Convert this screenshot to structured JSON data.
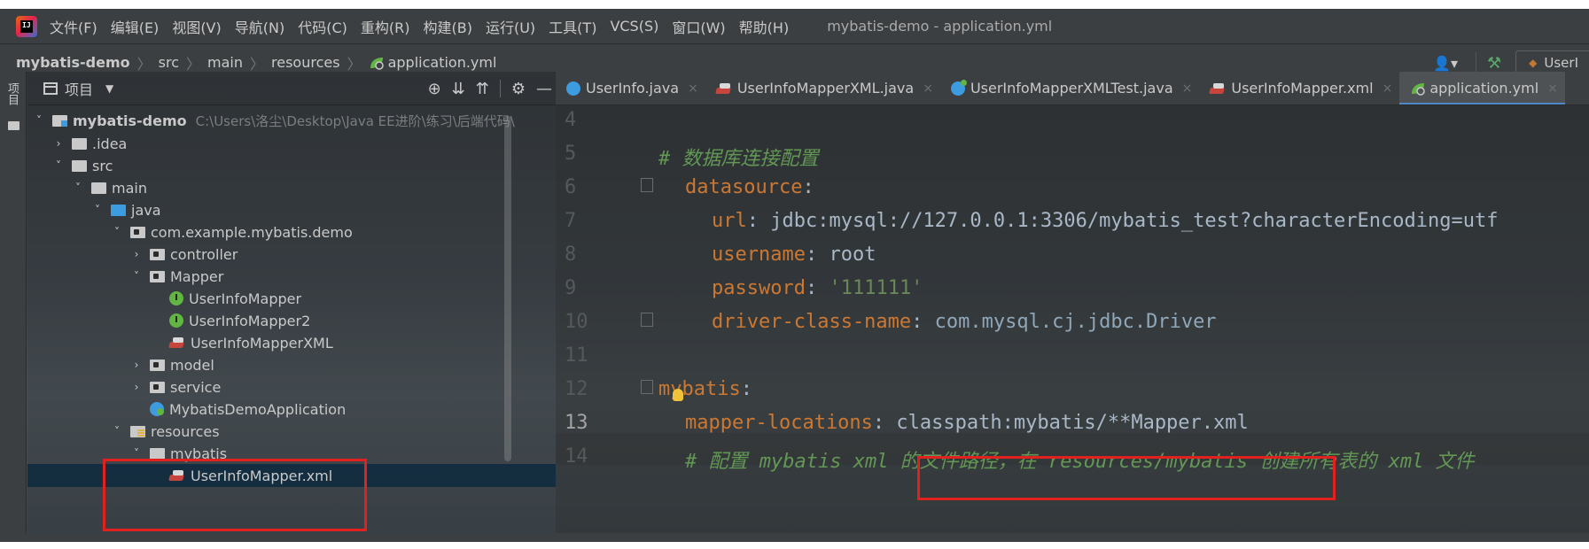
{
  "menubar": {
    "logo_text": "IJ",
    "items": [
      "文件(F)",
      "编辑(E)",
      "视图(V)",
      "导航(N)",
      "代码(C)",
      "重构(R)",
      "构建(B)",
      "运行(U)",
      "工具(T)",
      "VCS(S)",
      "窗口(W)",
      "帮助(H)"
    ],
    "window_title": "mybatis-demo - application.yml"
  },
  "navbar": {
    "breadcrumbs": [
      "mybatis-demo",
      "src",
      "main",
      "resources",
      "application.yml"
    ],
    "run_config": "UserI"
  },
  "left_stripe": {
    "label": "项目"
  },
  "project_panel": {
    "title": "项目",
    "tree": [
      {
        "label": "mybatis-demo",
        "detail": "C:\\Users\\洛尘\\Desktop\\Java EE进阶\\练习\\后端代码\\"
      },
      {
        "label": ".idea"
      },
      {
        "label": "src"
      },
      {
        "label": "main"
      },
      {
        "label": "java"
      },
      {
        "label": "com.example.mybatis.demo"
      },
      {
        "label": "controller"
      },
      {
        "label": "Mapper"
      },
      {
        "label": "UserInfoMapper",
        "icon": "I"
      },
      {
        "label": "UserInfoMapper2",
        "icon": "I"
      },
      {
        "label": "UserInfoMapperXML"
      },
      {
        "label": "model"
      },
      {
        "label": "service"
      },
      {
        "label": "MybatisDemoApplication"
      },
      {
        "label": "resources"
      },
      {
        "label": "mybatis"
      },
      {
        "label": "UserInfoMapper.xml"
      }
    ]
  },
  "editor": {
    "tabs": [
      {
        "label": "UserInfo.java"
      },
      {
        "label": "UserInfoMapperXML.java"
      },
      {
        "label": "UserInfoMapperXMLTest.java"
      },
      {
        "label": "UserInfoMapper.xml"
      },
      {
        "label": "application.yml",
        "active": true
      }
    ],
    "line_numbers": [
      "4",
      "5",
      "6",
      "7",
      "8",
      "9",
      "10",
      "11",
      "12",
      "13",
      "14"
    ],
    "code": {
      "l5_comment": "# 数据库连接配置",
      "l6_key": "datasource",
      "l7_key": "url",
      "l7_val": "jdbc:mysql://127.0.0.1:3306/mybatis_test?characterEncoding=utf",
      "l8_key": "username",
      "l8_val": "root",
      "l9_key": "password",
      "l9_val": "'111111'",
      "l10_key": "driver-class-name",
      "l10_val": "com.mysql.cj.jdbc.Driver",
      "l12_key": "mybatis",
      "l13_key": "mapper-locations",
      "l13_val": "classpath:mybatis/**Mapper.xml",
      "l14_comment": "# 配置 mybatis xml 的文件路径，在 resources/mybatis 创建所有表的 xml 文件"
    }
  },
  "colors": {
    "yaml_key": "#cc7832",
    "yaml_string": "#6a8759",
    "comment": "#629755",
    "highlight_box": "#e0211d",
    "selection": "#0d293e"
  }
}
